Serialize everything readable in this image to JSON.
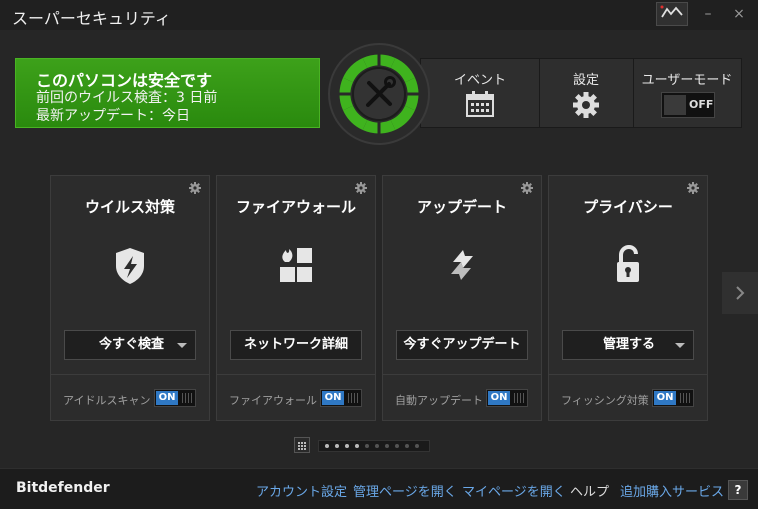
{
  "window": {
    "title": "スーパーセキュリティ",
    "graph_icon": "activity-graph-icon",
    "minimize_label": "–",
    "close_label": "×"
  },
  "status": {
    "title": "このパソコンは安全です",
    "last_scan": "前回のウイルス検査：3 日前",
    "last_update": "最新アップデート：今日",
    "color": "#3a9d17"
  },
  "topbar": {
    "events_label": "イベント",
    "settings_label": "設定",
    "user_mode_label": "ユーザーモード",
    "user_mode_state": "OFF"
  },
  "cards": [
    {
      "title": "ウイルス対策",
      "icon": "shield-icon",
      "action": "今すぐ検査",
      "has_dropdown": true,
      "feature_label": "アイドルスキャン",
      "toggle": "ON"
    },
    {
      "title": "ファイアウォール",
      "icon": "firewall-icon",
      "action": "ネットワーク詳細",
      "has_dropdown": false,
      "feature_label": "ファイアウォール",
      "toggle": "ON"
    },
    {
      "title": "アップデート",
      "icon": "update-arrows-icon",
      "action": "今すぐアップデート",
      "has_dropdown": false,
      "feature_label": "自動アップデート",
      "toggle": "ON"
    },
    {
      "title": "プライバシー",
      "icon": "padlock-icon",
      "action": "管理する",
      "has_dropdown": true,
      "feature_label": "フィッシング対策",
      "toggle": "ON"
    }
  ],
  "pager": {
    "active_dots": 4,
    "total_dots": 10
  },
  "footer": {
    "brand": "Bitdefender",
    "links": [
      "アカウント設定",
      "管理ページを開く",
      "マイページを開く",
      "ヘルプ",
      "追加購入サービス"
    ],
    "help_button": "?"
  },
  "colors": {
    "accent_green": "#3fb31e",
    "toggle_blue": "#2f78c4",
    "link_blue": "#6aa8e8"
  }
}
